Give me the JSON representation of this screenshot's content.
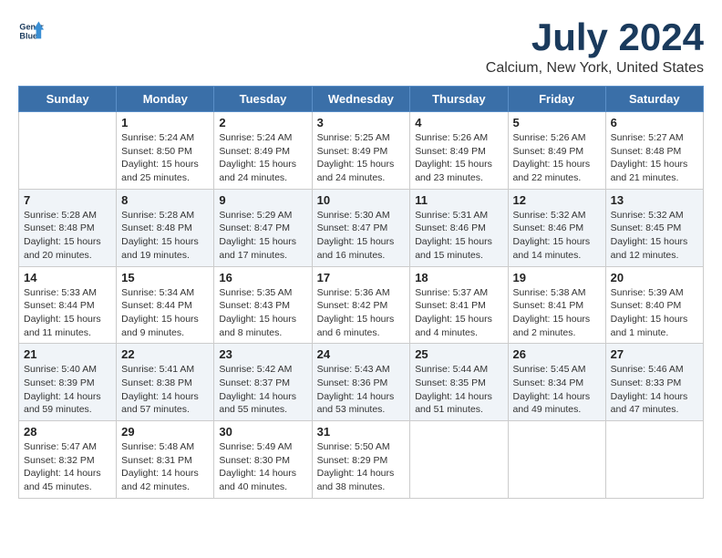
{
  "header": {
    "logo_line1": "General",
    "logo_line2": "Blue",
    "month_year": "July 2024",
    "location": "Calcium, New York, United States"
  },
  "weekdays": [
    "Sunday",
    "Monday",
    "Tuesday",
    "Wednesday",
    "Thursday",
    "Friday",
    "Saturday"
  ],
  "weeks": [
    [
      {
        "day": "",
        "info": ""
      },
      {
        "day": "1",
        "info": "Sunrise: 5:24 AM\nSunset: 8:50 PM\nDaylight: 15 hours\nand 25 minutes."
      },
      {
        "day": "2",
        "info": "Sunrise: 5:24 AM\nSunset: 8:49 PM\nDaylight: 15 hours\nand 24 minutes."
      },
      {
        "day": "3",
        "info": "Sunrise: 5:25 AM\nSunset: 8:49 PM\nDaylight: 15 hours\nand 24 minutes."
      },
      {
        "day": "4",
        "info": "Sunrise: 5:26 AM\nSunset: 8:49 PM\nDaylight: 15 hours\nand 23 minutes."
      },
      {
        "day": "5",
        "info": "Sunrise: 5:26 AM\nSunset: 8:49 PM\nDaylight: 15 hours\nand 22 minutes."
      },
      {
        "day": "6",
        "info": "Sunrise: 5:27 AM\nSunset: 8:48 PM\nDaylight: 15 hours\nand 21 minutes."
      }
    ],
    [
      {
        "day": "7",
        "info": "Sunrise: 5:28 AM\nSunset: 8:48 PM\nDaylight: 15 hours\nand 20 minutes."
      },
      {
        "day": "8",
        "info": "Sunrise: 5:28 AM\nSunset: 8:48 PM\nDaylight: 15 hours\nand 19 minutes."
      },
      {
        "day": "9",
        "info": "Sunrise: 5:29 AM\nSunset: 8:47 PM\nDaylight: 15 hours\nand 17 minutes."
      },
      {
        "day": "10",
        "info": "Sunrise: 5:30 AM\nSunset: 8:47 PM\nDaylight: 15 hours\nand 16 minutes."
      },
      {
        "day": "11",
        "info": "Sunrise: 5:31 AM\nSunset: 8:46 PM\nDaylight: 15 hours\nand 15 minutes."
      },
      {
        "day": "12",
        "info": "Sunrise: 5:32 AM\nSunset: 8:46 PM\nDaylight: 15 hours\nand 14 minutes."
      },
      {
        "day": "13",
        "info": "Sunrise: 5:32 AM\nSunset: 8:45 PM\nDaylight: 15 hours\nand 12 minutes."
      }
    ],
    [
      {
        "day": "14",
        "info": "Sunrise: 5:33 AM\nSunset: 8:44 PM\nDaylight: 15 hours\nand 11 minutes."
      },
      {
        "day": "15",
        "info": "Sunrise: 5:34 AM\nSunset: 8:44 PM\nDaylight: 15 hours\nand 9 minutes."
      },
      {
        "day": "16",
        "info": "Sunrise: 5:35 AM\nSunset: 8:43 PM\nDaylight: 15 hours\nand 8 minutes."
      },
      {
        "day": "17",
        "info": "Sunrise: 5:36 AM\nSunset: 8:42 PM\nDaylight: 15 hours\nand 6 minutes."
      },
      {
        "day": "18",
        "info": "Sunrise: 5:37 AM\nSunset: 8:41 PM\nDaylight: 15 hours\nand 4 minutes."
      },
      {
        "day": "19",
        "info": "Sunrise: 5:38 AM\nSunset: 8:41 PM\nDaylight: 15 hours\nand 2 minutes."
      },
      {
        "day": "20",
        "info": "Sunrise: 5:39 AM\nSunset: 8:40 PM\nDaylight: 15 hours\nand 1 minute."
      }
    ],
    [
      {
        "day": "21",
        "info": "Sunrise: 5:40 AM\nSunset: 8:39 PM\nDaylight: 14 hours\nand 59 minutes."
      },
      {
        "day": "22",
        "info": "Sunrise: 5:41 AM\nSunset: 8:38 PM\nDaylight: 14 hours\nand 57 minutes."
      },
      {
        "day": "23",
        "info": "Sunrise: 5:42 AM\nSunset: 8:37 PM\nDaylight: 14 hours\nand 55 minutes."
      },
      {
        "day": "24",
        "info": "Sunrise: 5:43 AM\nSunset: 8:36 PM\nDaylight: 14 hours\nand 53 minutes."
      },
      {
        "day": "25",
        "info": "Sunrise: 5:44 AM\nSunset: 8:35 PM\nDaylight: 14 hours\nand 51 minutes."
      },
      {
        "day": "26",
        "info": "Sunrise: 5:45 AM\nSunset: 8:34 PM\nDaylight: 14 hours\nand 49 minutes."
      },
      {
        "day": "27",
        "info": "Sunrise: 5:46 AM\nSunset: 8:33 PM\nDaylight: 14 hours\nand 47 minutes."
      }
    ],
    [
      {
        "day": "28",
        "info": "Sunrise: 5:47 AM\nSunset: 8:32 PM\nDaylight: 14 hours\nand 45 minutes."
      },
      {
        "day": "29",
        "info": "Sunrise: 5:48 AM\nSunset: 8:31 PM\nDaylight: 14 hours\nand 42 minutes."
      },
      {
        "day": "30",
        "info": "Sunrise: 5:49 AM\nSunset: 8:30 PM\nDaylight: 14 hours\nand 40 minutes."
      },
      {
        "day": "31",
        "info": "Sunrise: 5:50 AM\nSunset: 8:29 PM\nDaylight: 14 hours\nand 38 minutes."
      },
      {
        "day": "",
        "info": ""
      },
      {
        "day": "",
        "info": ""
      },
      {
        "day": "",
        "info": ""
      }
    ]
  ]
}
